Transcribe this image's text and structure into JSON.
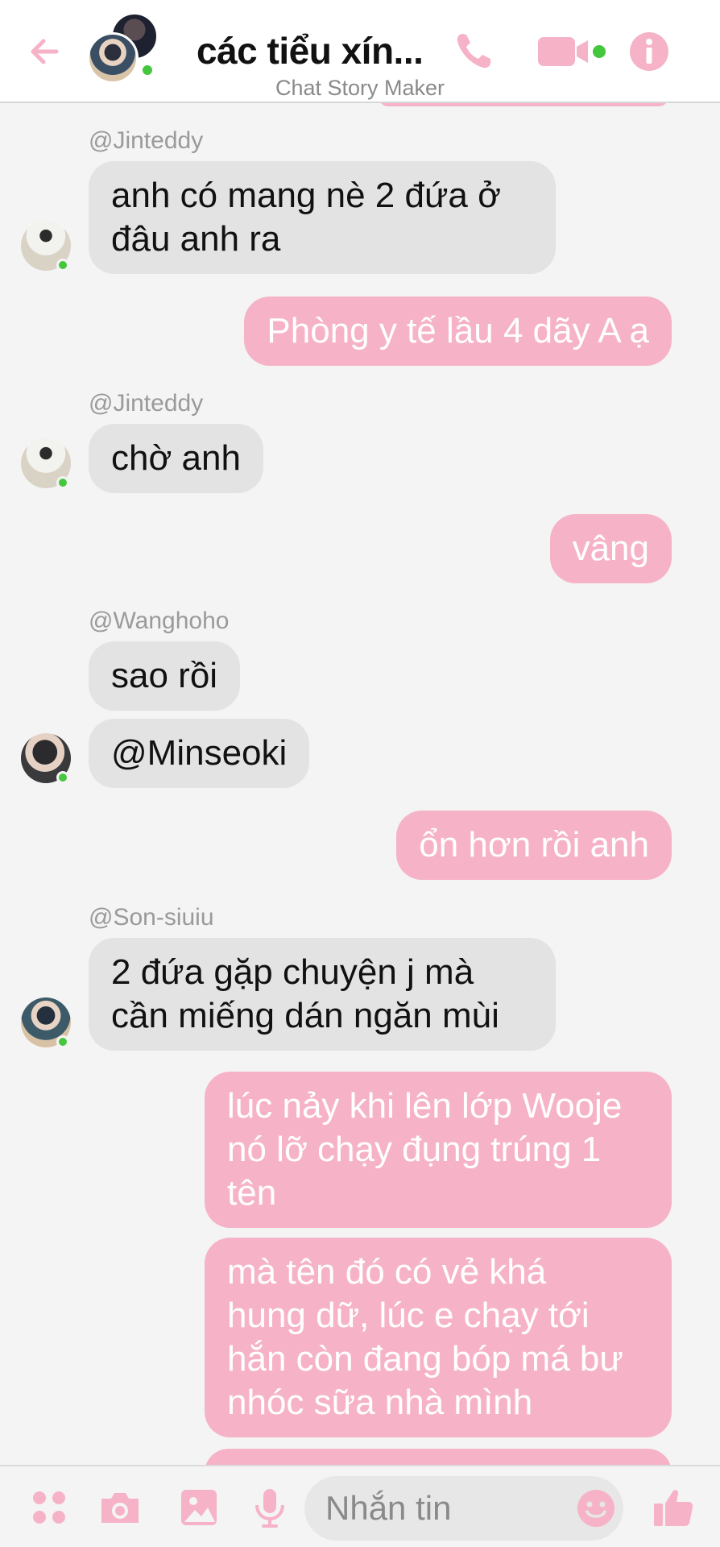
{
  "header": {
    "title": "các tiểu xín...",
    "subtitle": "Chat Story Maker",
    "icons": [
      "back-arrow-icon",
      "phone-icon",
      "video-camera-icon",
      "info-icon"
    ]
  },
  "colors": {
    "accent": "#f6b3c8",
    "incoming_bubble": "#e3e3e3",
    "online": "#44c63d",
    "background": "#f4f4f4"
  },
  "messages": [
    {
      "sender": "@Jinteddy",
      "text_lines": [
        "anh có mang nè 2 đứa ở",
        "đâu anh ra"
      ],
      "direction": "in"
    },
    {
      "text": "Phòng y tế lầu 4 dãy A ạ",
      "direction": "out"
    },
    {
      "sender": "@Jinteddy",
      "text": "chờ anh",
      "direction": "in"
    },
    {
      "text": "vâng",
      "direction": "out"
    },
    {
      "sender": "@Wanghoho",
      "text": "sao rồi",
      "direction": "in"
    },
    {
      "text": "@Minseoki",
      "direction": "in"
    },
    {
      "text": "ổn hơn rồi anh",
      "direction": "out"
    },
    {
      "sender": "@Son-siuiu",
      "text_lines": [
        "2 đứa gặp chuyện j mà",
        "cần miếng dán ngăn mùi"
      ],
      "direction": "in"
    },
    {
      "text_lines": [
        "lúc nảy khi lên lớp Wooje",
        "nó lỡ chạy đụng trúng 1",
        "tên"
      ],
      "direction": "out"
    },
    {
      "text_lines": [
        "mà tên đó có vẻ khá",
        "hung dữ, lúc e chạy tới",
        "hắn còn đang bóp má bư",
        "nhóc sữa nhà mình"
      ],
      "direction": "out"
    }
  ],
  "composer": {
    "placeholder": "Nhắn tin",
    "icons": [
      "apps-icon",
      "camera-icon",
      "image-icon",
      "microphone-icon",
      "emoji-icon",
      "thumbs-up-icon"
    ]
  }
}
